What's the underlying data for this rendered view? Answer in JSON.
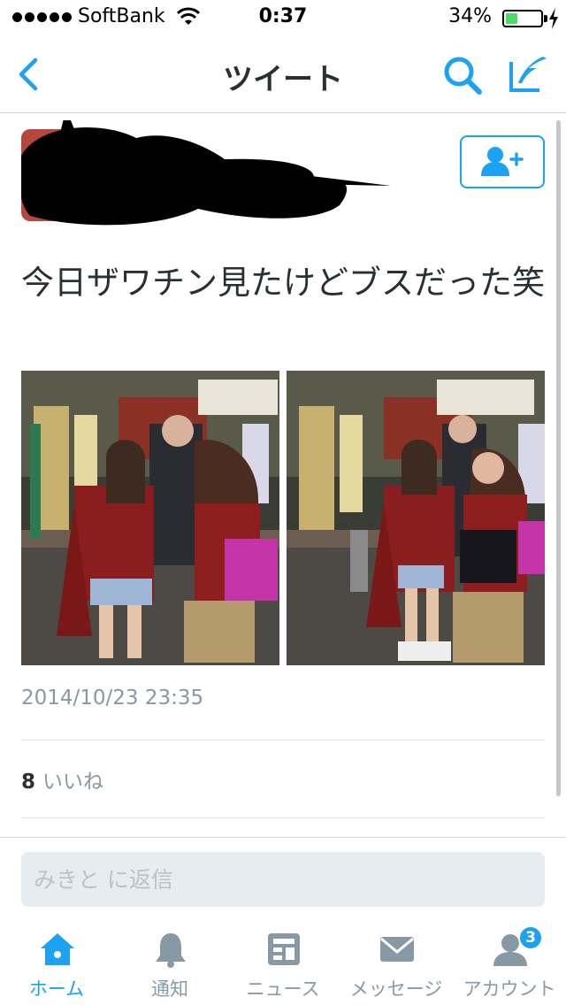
{
  "status_bar": {
    "carrier": "SoftBank",
    "time": "0:37",
    "battery_percent": "34%",
    "battery_level": 0.34
  },
  "nav": {
    "title": "ツイート",
    "back_icon": "chevron-left-icon",
    "search_icon": "search-icon",
    "compose_icon": "compose-icon"
  },
  "tweet": {
    "author_name_redacted": true,
    "follow_icon": "add-user-icon",
    "text": "今日ザワチン見たけどブスだった笑",
    "timestamp": "2014/10/23 23:35",
    "like_count": "8",
    "like_label": "いいね",
    "media_count": 2
  },
  "reply": {
    "placeholder": "みきと に返信"
  },
  "tabs": [
    {
      "label": "ホーム",
      "icon": "home-icon",
      "active": true
    },
    {
      "label": "通知",
      "icon": "bell-icon",
      "active": false
    },
    {
      "label": "ニュース",
      "icon": "news-icon",
      "active": false
    },
    {
      "label": "メッセージ",
      "icon": "envelope-icon",
      "active": false
    },
    {
      "label": "アカウント",
      "icon": "account-icon",
      "active": false,
      "badge": "3"
    }
  ],
  "colors": {
    "accent": "#1da1f2",
    "text": "#292f33",
    "secondary": "#8899a6",
    "divider": "#e1e8ed"
  }
}
